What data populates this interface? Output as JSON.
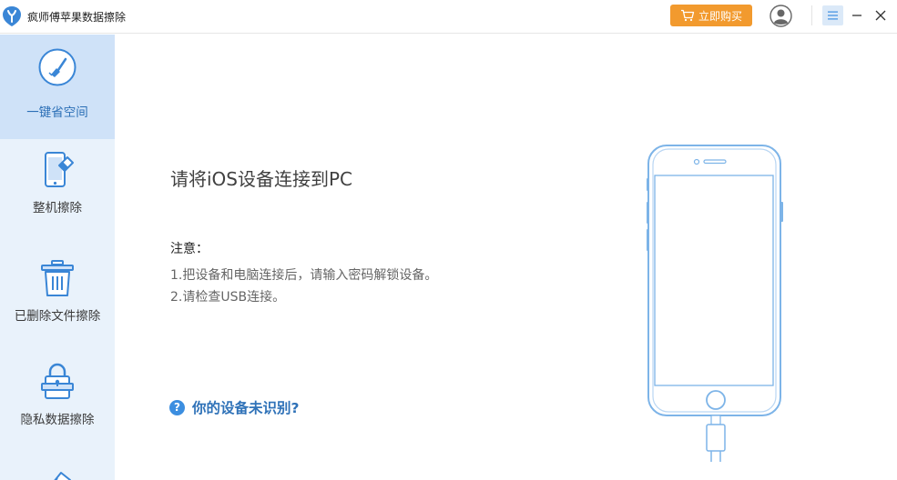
{
  "app": {
    "title": "疯师傅苹果数据擦除"
  },
  "header": {
    "buy_label": "立即购买"
  },
  "sidebar": {
    "items": [
      {
        "label": "一键省空间",
        "icon": "broom-icon",
        "active": true
      },
      {
        "label": "整机擦除",
        "icon": "phone-eraser-icon",
        "active": false
      },
      {
        "label": "已删除文件擦除",
        "icon": "trash-icon",
        "active": false
      },
      {
        "label": "隐私数据擦除",
        "icon": "lock-icon",
        "active": false
      }
    ]
  },
  "main": {
    "heading": "请将iOS设备连接到PC",
    "note_title": "注意：",
    "notes": [
      "1.把设备和电脑连接后，请输入密码解锁设备。",
      "2.请检查USB连接。"
    ],
    "help_link": "你的设备未识别?",
    "help_icon": "?"
  },
  "colors": {
    "accent": "#3c8ee0",
    "buy_button": "#f29a2e",
    "sidebar_bg": "#e9f2fb",
    "sidebar_active": "#cfe2f8",
    "link": "#2f72b8"
  }
}
